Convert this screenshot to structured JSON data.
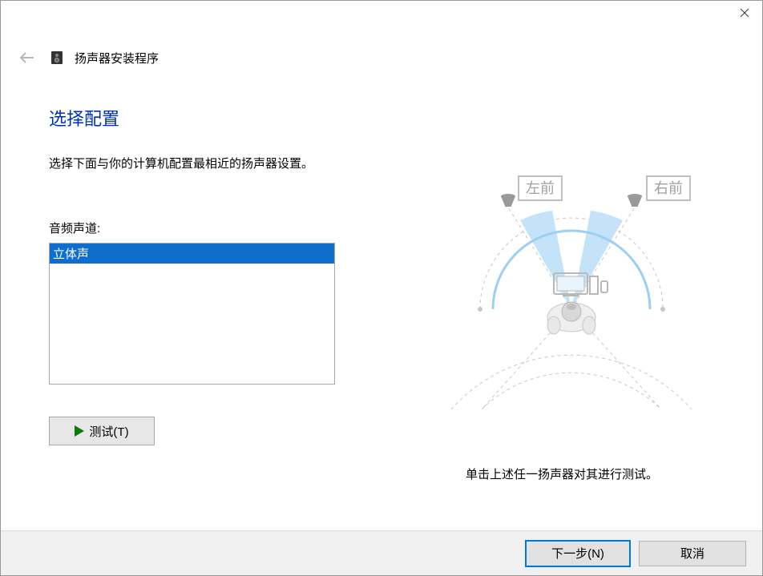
{
  "window": {
    "title": "扬声器安装程序"
  },
  "page": {
    "heading": "选择配置",
    "description": "选择下面与你的计算机配置最相近的扬声器设置。",
    "list_label": "音频声道:",
    "options": [
      "立体声"
    ],
    "selected_index": 0,
    "test_button": "测试(T)"
  },
  "diagram": {
    "left_label": "左前",
    "right_label": "右前",
    "help_text": "单击上述任一扬声器对其进行测试。"
  },
  "footer": {
    "next": "下一步(N)",
    "cancel": "取消"
  }
}
